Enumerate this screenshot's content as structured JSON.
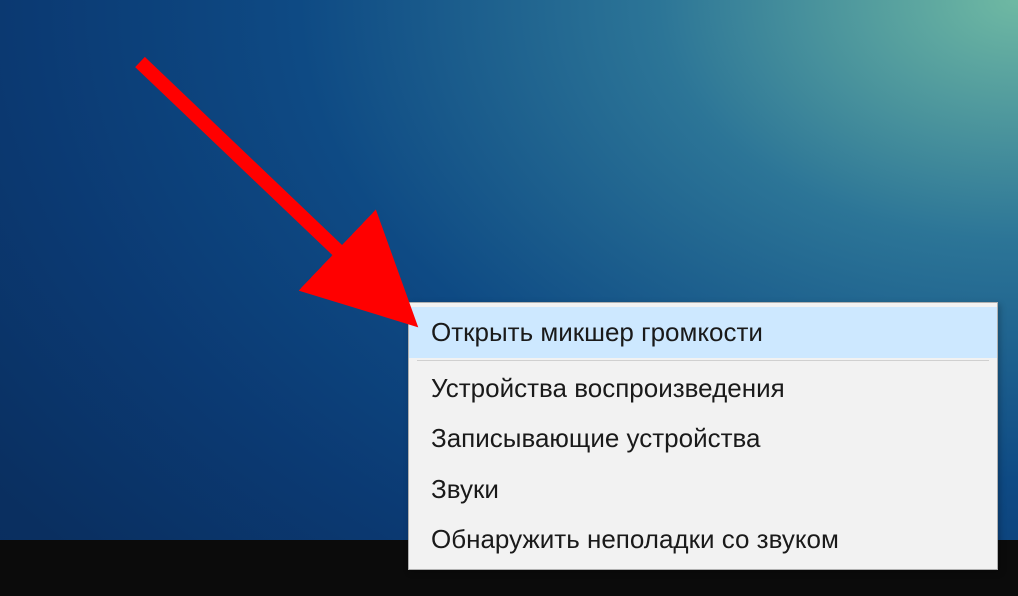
{
  "menu": {
    "items": [
      {
        "label": "Открыть микшер громкости",
        "highlighted": true
      },
      {
        "label": "Устройства воспроизведения",
        "highlighted": false
      },
      {
        "label": "Записывающие устройства",
        "highlighted": false
      },
      {
        "label": "Звуки",
        "highlighted": false
      },
      {
        "label": "Обнаружить неполадки со звуком",
        "highlighted": false
      }
    ]
  },
  "annotation": {
    "arrow_color": "#ff0000"
  }
}
